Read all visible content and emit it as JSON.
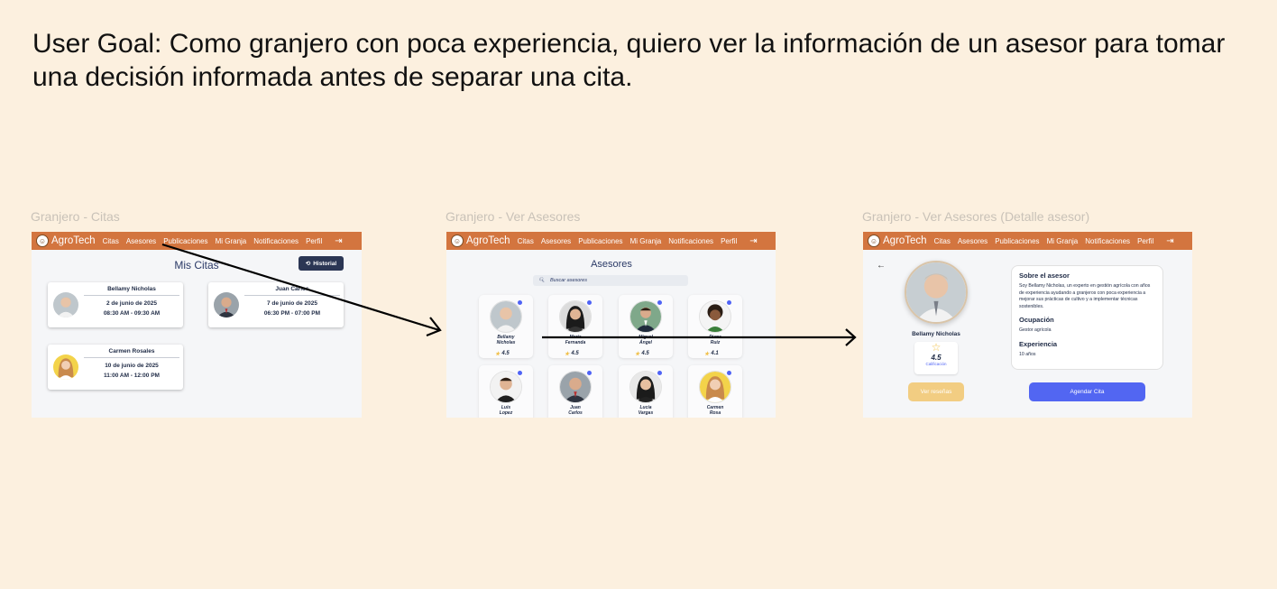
{
  "goal": "User Goal: Como granjero con poca experiencia, quiero ver la información de un asesor para tomar una decisión informada antes de separar una cita.",
  "brand": {
    "name": "AgroTech"
  },
  "nav": {
    "items": [
      "Citas",
      "Asesores",
      "Publicaciones",
      "Mi Granja",
      "Notificaciones",
      "Perfil"
    ],
    "logout_icon": "logout-icon"
  },
  "screens": [
    {
      "title": "Granjero - Citas",
      "page_title": "Mis Citas",
      "history_button": "Historial",
      "appointments": [
        {
          "name": "Bellamy Nicholas",
          "date": "2 de junio de 2025",
          "time": "08:30 AM - 09:30 AM"
        },
        {
          "name": "Juan Carlos",
          "date": "7 de junio de 2025",
          "time": "06:30 PM - 07:00 PM"
        },
        {
          "name": "Carmen Rosales",
          "date": "10 de junio de 2025",
          "time": "11:00 AM - 12:00 PM"
        }
      ]
    },
    {
      "title": "Granjero - Ver Asesores",
      "page_title": "Asesores",
      "search_placeholder": "Buscar asesores",
      "advisors": [
        {
          "name_line1": "Bellamy",
          "name_line2": "Nicholas",
          "rating": "4.5"
        },
        {
          "name_line1": "María",
          "name_line2": "Fernanda",
          "rating": "4.5"
        },
        {
          "name_line1": "Miguel",
          "name_line2": "Ángel",
          "rating": "4.5"
        },
        {
          "name_line1": "Diana",
          "name_line2": "Ruiz",
          "rating": "4.1"
        },
        {
          "name_line1": "Luis",
          "name_line2": "Lopez",
          "rating": ""
        },
        {
          "name_line1": "Juan",
          "name_line2": "Carlos",
          "rating": ""
        },
        {
          "name_line1": "Lucia",
          "name_line2": "Vargas",
          "rating": ""
        },
        {
          "name_line1": "Carmen",
          "name_line2": "Rosa",
          "rating": ""
        }
      ]
    },
    {
      "title": "Granjero - Ver Asesores (Detalle asesor)",
      "name": "Bellamy Nicholas",
      "rating": "4.5",
      "rating_label": "Calificación",
      "about_title": "Sobre el asesor",
      "about_text": "Soy Bellamy Nicholas, un experto en gestión agrícola con años de experiencia ayudando a granjeros con poca experiencia a mejorar sus prácticas de cultivo y a implementar técnicas sostenibles.",
      "occupation_title": "Ocupación",
      "occupation": "Gestor agrícola",
      "experience_title": "Experiencia",
      "experience": "10 años",
      "reviews_button": "Ver reseñas",
      "schedule_button": "Agendar Cita"
    }
  ],
  "colors": {
    "background": "#fcf0df",
    "nav": "#d3753f",
    "accent_blue": "#5266f2",
    "accent_yellow": "#f2cd82",
    "star": "#f1c04a",
    "dark_button": "#2b3654"
  }
}
